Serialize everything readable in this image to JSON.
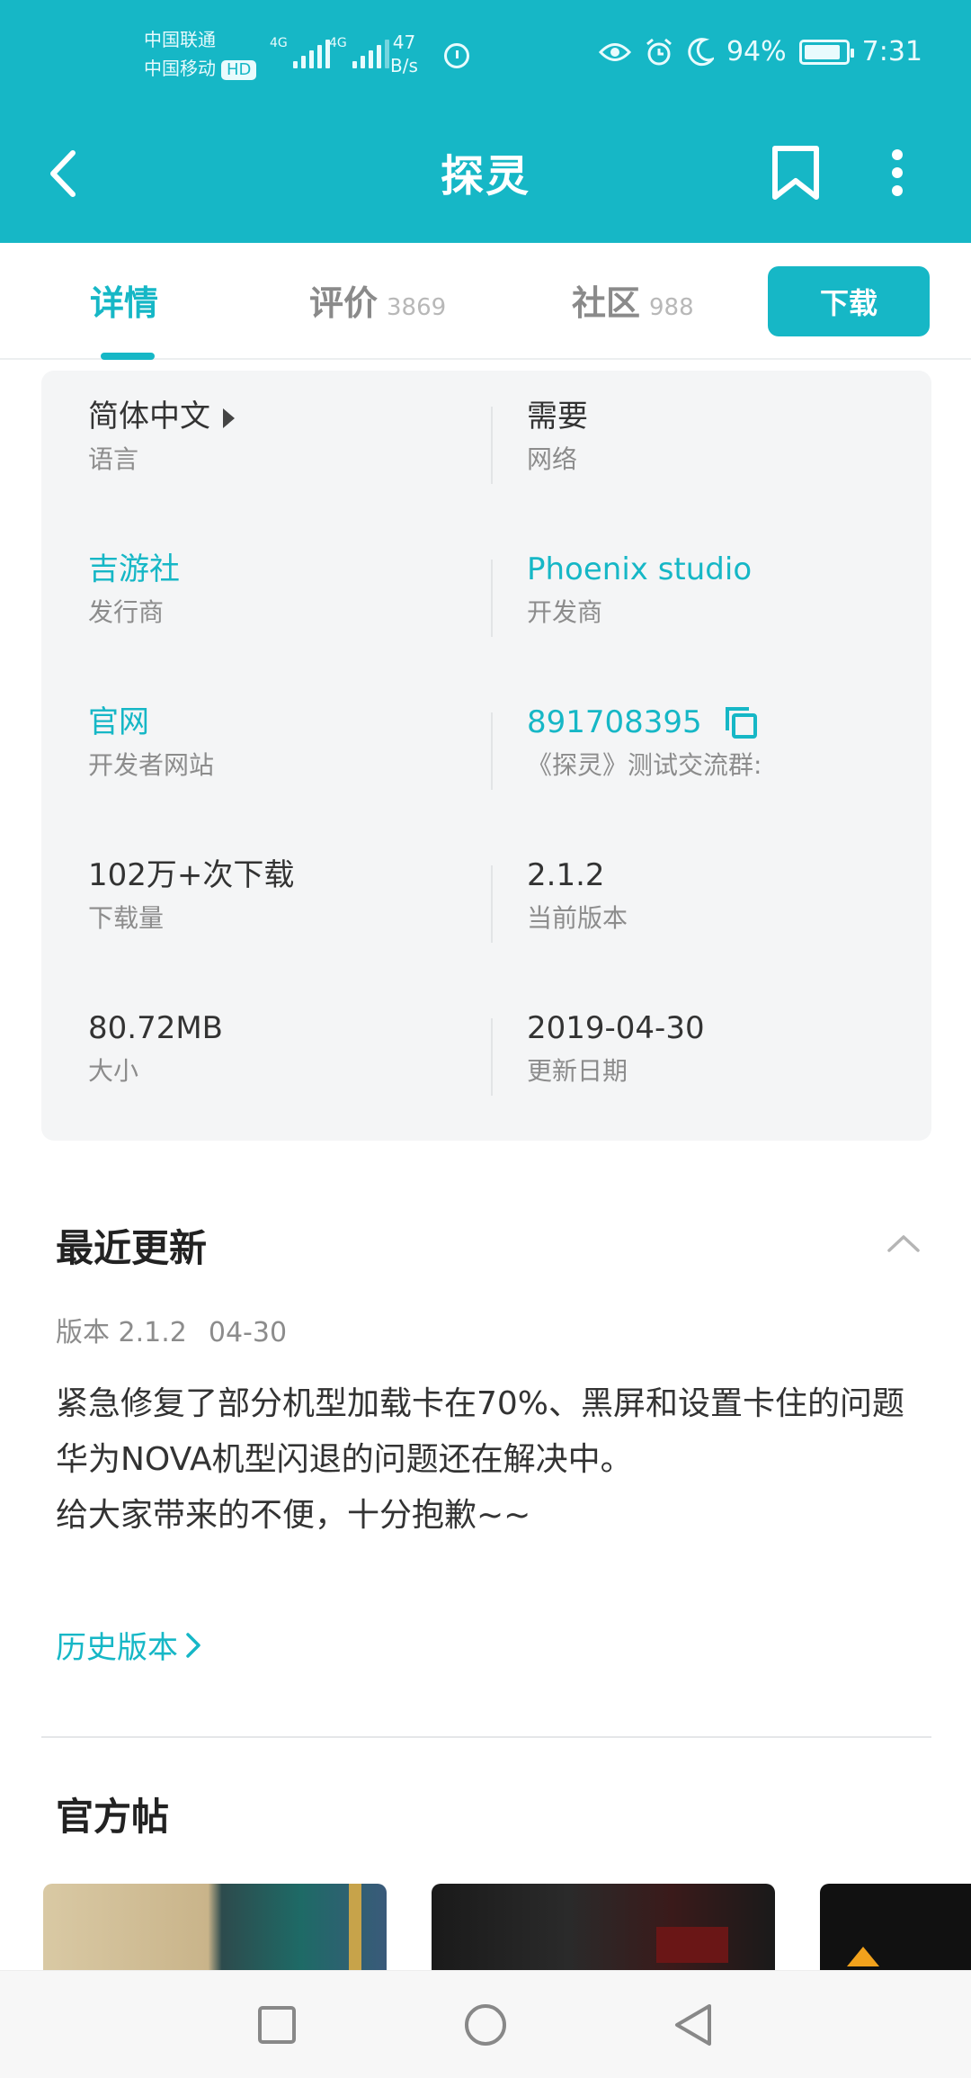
{
  "status_bar": {
    "carrier_1": "中国联通",
    "carrier_2": "中国移动",
    "hd_badge": "HD",
    "net_1": "4G",
    "net_2": "4G",
    "speed_value": "47",
    "speed_unit": "B/s",
    "battery": "94%",
    "time": "7:31"
  },
  "app_bar": {
    "title": "探灵"
  },
  "tabs": [
    {
      "label": "详情",
      "count": ""
    },
    {
      "label": "评价",
      "count": "3869"
    },
    {
      "label": "社区",
      "count": "988"
    }
  ],
  "download_button": "下载",
  "info": {
    "language": {
      "value": "简体中文",
      "label": "语言"
    },
    "network": {
      "value": "需要",
      "label": "网络"
    },
    "publisher": {
      "value": "吉游社",
      "label": "发行商"
    },
    "developer": {
      "value": "Phoenix studio",
      "label": "开发商"
    },
    "website": {
      "value": "官网",
      "label": "开发者网站"
    },
    "qq_group": {
      "value": "891708395",
      "label": "《探灵》测试交流群:"
    },
    "downloads": {
      "value": "102万+次下载",
      "label": "下载量"
    },
    "version": {
      "value": "2.1.2",
      "label": "当前版本"
    },
    "size": {
      "value": "80.72MB",
      "label": "大小"
    },
    "update_date": {
      "value": "2019-04-30",
      "label": "更新日期"
    }
  },
  "recent_update": {
    "title": "最近更新",
    "version_label": "版本 2.1.2",
    "version_date": "04-30",
    "notes": [
      "紧急修复了部分机型加载卡在70%、黑屏和设置卡住的问题",
      "华为NOVA机型闪退的问题还在解决中。",
      "给大家带来的不便，十分抱歉~~"
    ],
    "history_link": "历史版本"
  },
  "official_posts": {
    "title": "官方帖"
  },
  "colors": {
    "accent": "#16b7c6",
    "card_bg": "#f4f5f6"
  }
}
